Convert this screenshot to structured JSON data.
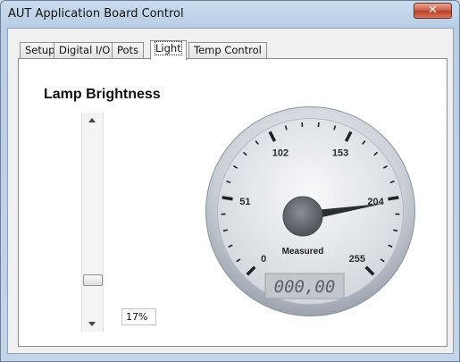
{
  "window": {
    "title": "AUT Application Board Control",
    "close_glyph": "✕"
  },
  "tabs": [
    {
      "label": "Setup"
    },
    {
      "label": "Digital I/O"
    },
    {
      "label": "Pots"
    },
    {
      "label": "Light"
    },
    {
      "label": "Temp Control"
    }
  ],
  "active_tab": "Light",
  "lamp": {
    "title": "Lamp Brightness",
    "slider_fraction": 0.17,
    "percent_text": "17%"
  },
  "gauge": {
    "min": 0,
    "max": 255,
    "tick_labels": [
      "0",
      "51",
      "102",
      "153",
      "204",
      "255"
    ],
    "needle_value": 204,
    "label": "Measured",
    "readout": "000,00"
  }
}
